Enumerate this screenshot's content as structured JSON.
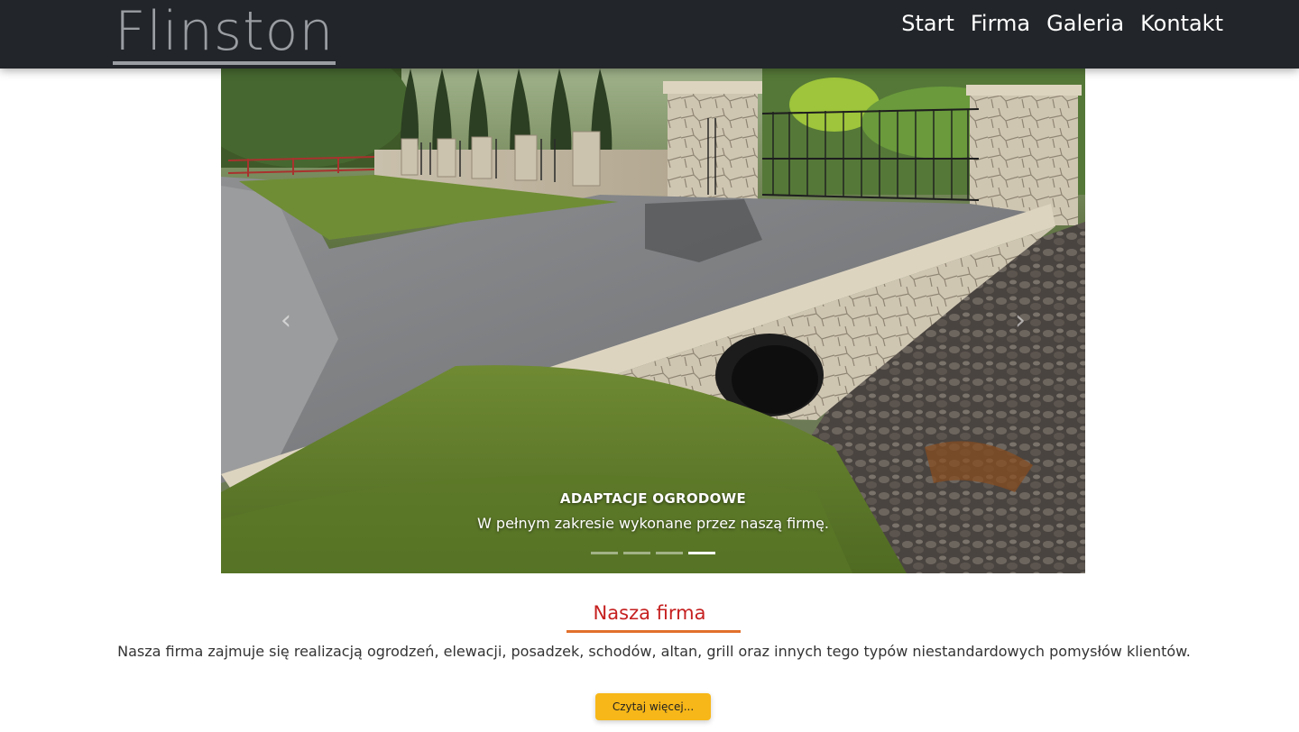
{
  "navbar": {
    "brand": "Flinston",
    "links": [
      {
        "label": "Start"
      },
      {
        "label": "Firma"
      },
      {
        "label": "Galeria"
      },
      {
        "label": "Kontakt"
      }
    ]
  },
  "carousel": {
    "prev_icon": "chevron-left-icon",
    "next_icon": "chevron-right-icon",
    "caption_title": "ADAPTACJE OGRODOWE",
    "caption_text": "W pełnym zakresie wykonane przez naszą firmę.",
    "slide_count": 4,
    "active_slide": 4
  },
  "about": {
    "title": "Nasza firma",
    "text": "Nasza firma zajmuje się realizacją ogrodzeń, elewacji, posadzek, schodów, altan, grill oraz innych tego typów niestandardowych pomysłów klientów.",
    "button_label": "Czytaj więcej..."
  },
  "colors": {
    "navbar_bg": "#222529",
    "brand": "#9a9ea3",
    "section_title": "#c62020",
    "title_underline": "#e2702c",
    "button_bg": "#f7b718"
  }
}
